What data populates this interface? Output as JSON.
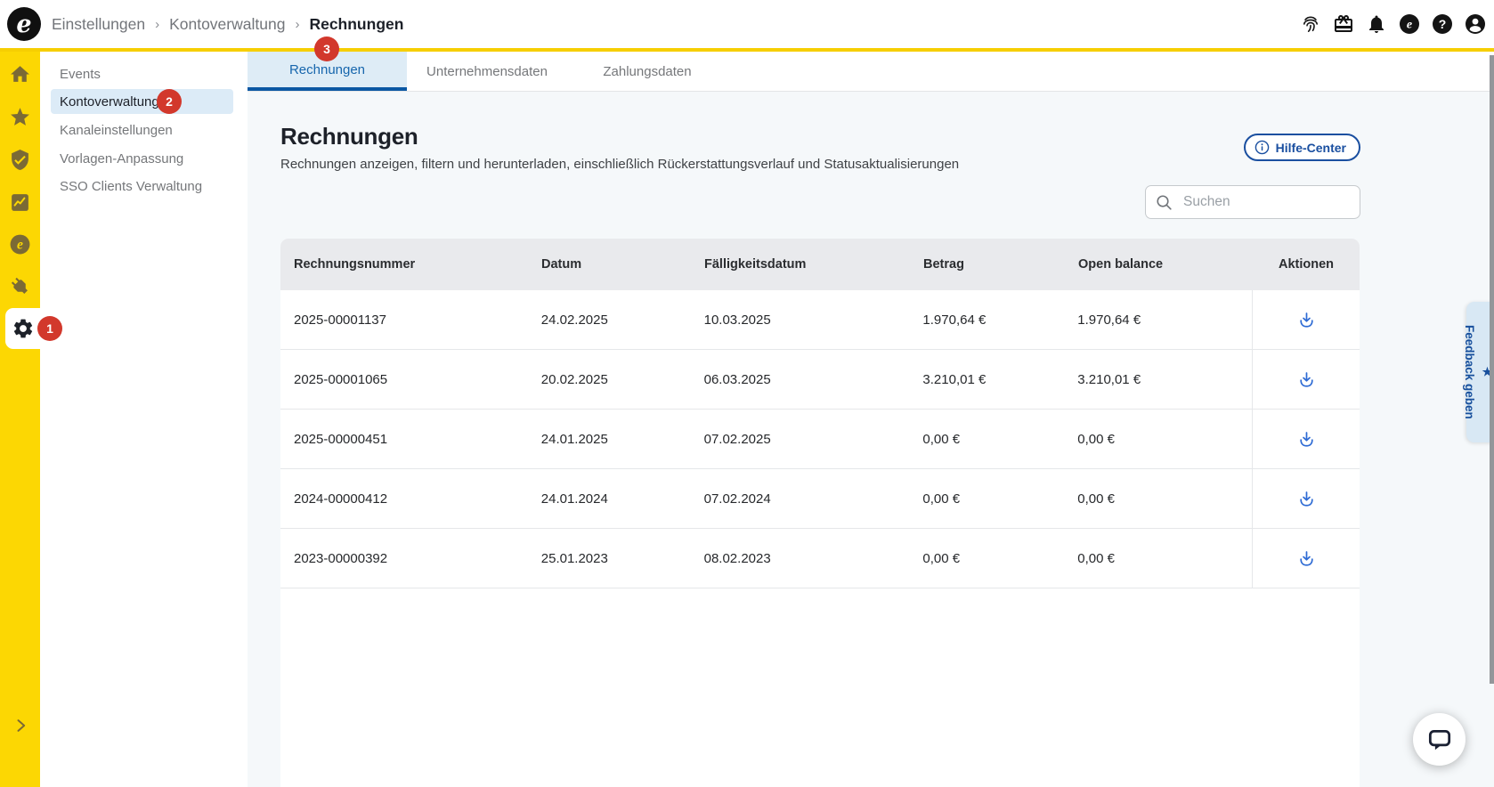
{
  "header": {
    "logo_letter": "e",
    "breadcrumb": {
      "separator": "›",
      "items": [
        "Einstellungen",
        "Kontoverwaltung",
        "Rechnungen"
      ]
    }
  },
  "rail": {
    "settings_badge": "1"
  },
  "sidebar": {
    "items": [
      {
        "label": "Events"
      },
      {
        "label": "Kontoverwaltung",
        "badge": "2"
      },
      {
        "label": "Kanaleinstellungen"
      },
      {
        "label": "Vorlagen-Anpassung"
      },
      {
        "label": "SSO Clients Verwaltung"
      }
    ]
  },
  "tabs": {
    "items": [
      {
        "label": "Rechnungen",
        "badge": "3"
      },
      {
        "label": "Unternehmensdaten"
      },
      {
        "label": "Zahlungsdaten"
      }
    ]
  },
  "page": {
    "title": "Rechnungen",
    "subtitle": "Rechnungen anzeigen, filtern und herunterladen, einschließlich Rückerstattungsverlauf und Statusaktualisierungen",
    "help_button_label": "Hilfe-Center",
    "search_placeholder": "Suchen"
  },
  "table": {
    "columns": [
      "Rechnungsnummer",
      "Datum",
      "Fälligkeitsdatum",
      "Betrag",
      "Open balance",
      "Aktionen"
    ],
    "rows": [
      [
        "2025-00001137",
        "24.02.2025",
        "10.03.2025",
        "1.970,64 €",
        "1.970,64 €"
      ],
      [
        "2025-00001065",
        "20.02.2025",
        "06.03.2025",
        "3.210,01 €",
        "3.210,01 €"
      ],
      [
        "2025-00000451",
        "24.01.2025",
        "07.02.2025",
        "0,00 €",
        "0,00 €"
      ],
      [
        "2024-00000412",
        "24.01.2024",
        "07.02.2024",
        "0,00 €",
        "0,00 €"
      ],
      [
        "2023-00000392",
        "25.01.2023",
        "08.02.2023",
        "0,00 €",
        "0,00 €"
      ]
    ]
  },
  "feedback": {
    "star": "★",
    "label": "Feedback geben"
  },
  "colors": {
    "brand_yellow": "#FCD703",
    "badge_red": "#D2382C",
    "active_blue": "#1766AD",
    "tab_underline": "#0A57A3",
    "tab_active_bg": "#DEECF6",
    "sidebar_active_bg": "#DCEBF7",
    "content_bg": "#F5F8FA",
    "table_header_bg": "#E9EAED",
    "download_blue": "#2E6BD4",
    "help_blue": "#1A4FA0",
    "feedback_bg": "#D8E8F4"
  }
}
